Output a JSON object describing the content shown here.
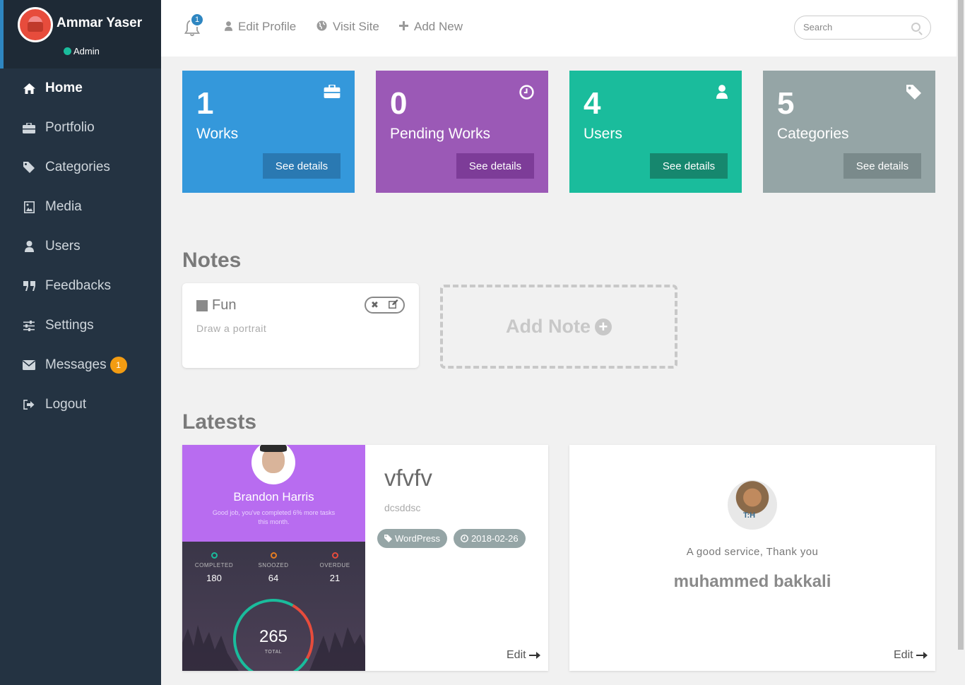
{
  "profile": {
    "name": "Ammar Yaser",
    "role": "Admin"
  },
  "nav": [
    {
      "label": "Home",
      "icon": "home-icon",
      "active": true
    },
    {
      "label": "Portfolio",
      "icon": "briefcase-icon"
    },
    {
      "label": "Categories",
      "icon": "tag-icon"
    },
    {
      "label": "Media",
      "icon": "image-icon"
    },
    {
      "label": "Users",
      "icon": "user-icon"
    },
    {
      "label": "Feedbacks",
      "icon": "quote-icon"
    },
    {
      "label": "Settings",
      "icon": "sliders-icon"
    },
    {
      "label": "Messages",
      "icon": "envelope-icon",
      "badge": "1"
    },
    {
      "label": "Logout",
      "icon": "sign-out-icon"
    }
  ],
  "topbar": {
    "notifications_count": "1",
    "edit_profile": "Edit Profile",
    "visit_site": "Visit Site",
    "add_new": "Add New",
    "search_placeholder": "Search"
  },
  "stats": [
    {
      "value": "1",
      "label": "Works",
      "button": "See details",
      "icon": "briefcase-icon",
      "color": "#3498db"
    },
    {
      "value": "0",
      "label": "Pending Works",
      "button": "See details",
      "icon": "clock-icon",
      "color": "#9b59b6"
    },
    {
      "value": "4",
      "label": "Users",
      "button": "See details",
      "icon": "user-icon",
      "color": "#1abc9c"
    },
    {
      "value": "5",
      "label": "Categories",
      "button": "See details",
      "icon": "tag-icon",
      "color": "#95a5a6"
    }
  ],
  "notes": {
    "title": "Notes",
    "items": [
      {
        "title": "Fun",
        "description": "Draw a portrait"
      }
    ],
    "add_label": "Add Note"
  },
  "latests": {
    "title": "Latests",
    "work": {
      "title": "vfvfv",
      "description": "dcsddsc",
      "category": "WordPress",
      "date": "2018-02-26",
      "edit_label": "Edit",
      "thumbnail": {
        "name": "Brandon Harris",
        "subtitle": "Good job, you've completed 6% more tasks this month.",
        "stats": [
          {
            "label": "COMPLETED",
            "value": "180",
            "color": "#1abc9c"
          },
          {
            "label": "SNOOZED",
            "value": "64",
            "color": "#e67e22"
          },
          {
            "label": "OVERDUE",
            "value": "21",
            "color": "#e74c3c"
          }
        ],
        "total_value": "265",
        "total_label": "TOTAL"
      }
    },
    "feedback": {
      "text": "A good service, Thank you",
      "name": "muhammed bakkali",
      "edit_label": "Edit"
    }
  }
}
